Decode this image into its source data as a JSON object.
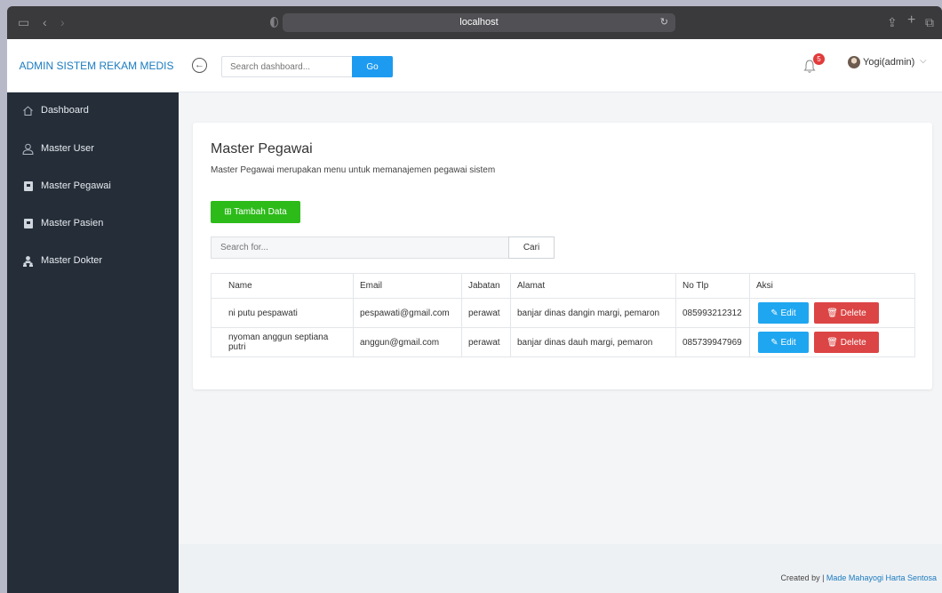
{
  "browser": {
    "url": "localhost",
    "reload_glyph": "↻"
  },
  "header": {
    "brand": "ADMIN SISTEM REKAM MEDIS",
    "search_placeholder": "Search dashboard...",
    "search_button": "Go",
    "notification_count": "5",
    "user_name": "Yogi(admin)"
  },
  "sidebar": {
    "items": [
      {
        "label": "Dashboard",
        "icon": "home-icon"
      },
      {
        "label": "Master User",
        "icon": "user-icon"
      },
      {
        "label": "Master Pegawai",
        "icon": "address-book-icon"
      },
      {
        "label": "Master Pasien",
        "icon": "address-book-icon"
      },
      {
        "label": "Master Dokter",
        "icon": "users-icon"
      }
    ]
  },
  "content": {
    "title": "Master Pegawai",
    "subtitle": "Master Pegawai merupakan menu untuk memanajemen pegawai sistem",
    "add_button": "⊞ Tambah Data",
    "filter_placeholder": "Search for...",
    "filter_button": "Cari"
  },
  "table": {
    "headers": [
      "Name",
      "Email",
      "Jabatan",
      "Alamat",
      "No Tlp",
      "Aksi"
    ],
    "rows": [
      {
        "name": "ni putu pespawati",
        "email": "pespawati@gmail.com",
        "jabatan": "perawat",
        "alamat": "banjar dinas dangin margi, pemaron",
        "no_tlp": "085993212312"
      },
      {
        "name": "nyoman anggun septiana putri",
        "email": "anggun@gmail.com",
        "jabatan": "perawat",
        "alamat": "banjar dinas dauh margi, pemaron",
        "no_tlp": "085739947969"
      }
    ],
    "edit_label": "✎ Edit",
    "delete_label": "🗑 Delete"
  },
  "footer": {
    "prefix": "Created by | ",
    "author": "Made Mahayogi Harta Sentosa"
  },
  "colors": {
    "brand": "#1b7bbf",
    "sidebar": "#252d38",
    "add_button": "#2dbb1a",
    "edit_button": "#1fa6f0",
    "delete_button": "#dc4545",
    "badge": "#e23b3b"
  }
}
